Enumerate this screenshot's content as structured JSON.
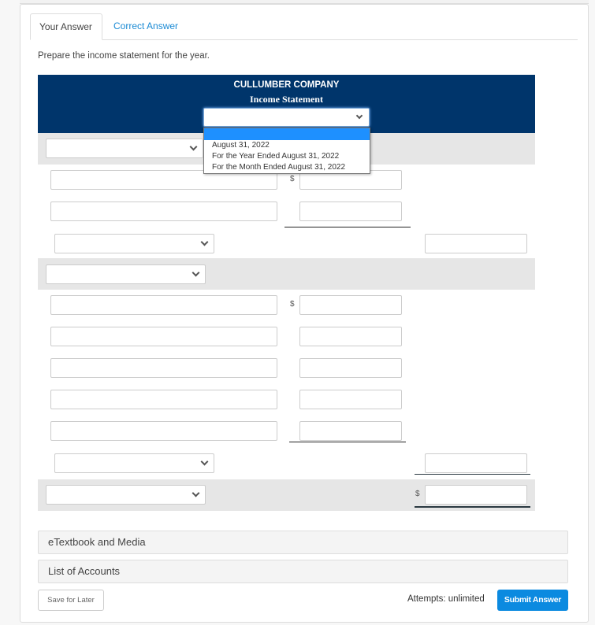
{
  "tabs": [
    {
      "label": "Your Answer",
      "active": true
    },
    {
      "label": "Correct Answer",
      "active": false
    }
  ],
  "prompt": "Prepare the income statement for the year.",
  "statement": {
    "company": "CULLUMBER COMPANY",
    "title": "Income Statement",
    "date_select": {
      "value": "",
      "open": true,
      "options": [
        "",
        "August 31, 2022",
        "For the Year Ended August 31, 2022",
        "For the Month Ended August 31, 2022"
      ],
      "highlighted_index": 0
    },
    "currency_symbol": "$",
    "section1": {
      "heading_select": "",
      "rows": [
        "",
        ""
      ],
      "total_select": "",
      "total_value": ""
    },
    "section2": {
      "heading_select": "",
      "rows": [
        "",
        "",
        "",
        "",
        ""
      ],
      "total_select": "",
      "total_value": ""
    },
    "net": {
      "label_select": "",
      "value": ""
    }
  },
  "accordions": [
    {
      "label": "eTextbook and Media"
    },
    {
      "label": "List of Accounts"
    }
  ],
  "footer": {
    "save_label": "Save for Later",
    "attempts": "Attempts: unlimited",
    "submit_label": "Submit Answer"
  },
  "colors": {
    "header_bg": "#00356b",
    "band_bg": "#e6e6e6",
    "link": "#1a8ad4",
    "submit_bg": "#0b8ae0",
    "highlight": "#1e90ff"
  }
}
